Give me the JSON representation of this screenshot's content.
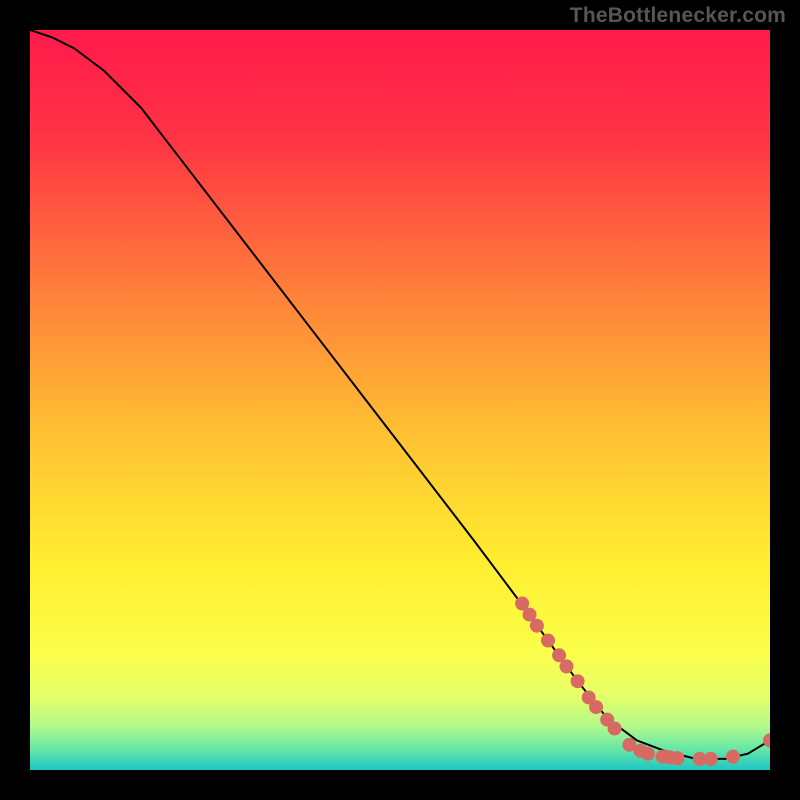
{
  "attribution": "TheBottlenecker.com",
  "colors": {
    "bg": "#000000",
    "line": "#000000",
    "marker": "#d76a63",
    "attribution": "#565656"
  },
  "chart_data": {
    "type": "line",
    "title": "",
    "xlabel": "",
    "ylabel": "",
    "xlim": [
      0,
      100
    ],
    "ylim": [
      0,
      100
    ],
    "grid": false,
    "legend": false,
    "background_gradient": {
      "stops": [
        {
          "pos": 0.0,
          "color": "#ff1a4b"
        },
        {
          "pos": 0.15,
          "color": "#ff3544"
        },
        {
          "pos": 0.35,
          "color": "#ff7e3a"
        },
        {
          "pos": 0.55,
          "color": "#ffc232"
        },
        {
          "pos": 0.72,
          "color": "#ffee2f"
        },
        {
          "pos": 0.84,
          "color": "#fbff4a"
        },
        {
          "pos": 0.9,
          "color": "#e6ff6a"
        },
        {
          "pos": 0.94,
          "color": "#b4f98a"
        },
        {
          "pos": 0.97,
          "color": "#6be8a6"
        },
        {
          "pos": 1.0,
          "color": "#1ec6c2"
        }
      ]
    },
    "series": [
      {
        "name": "bottleneck-curve",
        "x": [
          0,
          3,
          6,
          10,
          15,
          20,
          30,
          40,
          50,
          60,
          66,
          70,
          74,
          78,
          82,
          86,
          90,
          94,
          97,
          100
        ],
        "y": [
          100,
          99,
          97.5,
          94.5,
          89.5,
          83,
          70,
          57,
          44,
          31,
          23,
          17.5,
          12,
          7,
          4,
          2.5,
          1.5,
          1.5,
          2.2,
          4
        ]
      }
    ],
    "markers": [
      {
        "name": "cluster-upper-66",
        "x": 66.5,
        "y": 22.5
      },
      {
        "name": "cluster-upper-67",
        "x": 67.5,
        "y": 21.0
      },
      {
        "name": "cluster-upper-68",
        "x": 68.5,
        "y": 19.5
      },
      {
        "name": "cluster-upper-70",
        "x": 70.0,
        "y": 17.5
      },
      {
        "name": "cluster-upper-72a",
        "x": 71.5,
        "y": 15.5
      },
      {
        "name": "cluster-upper-72b",
        "x": 72.5,
        "y": 14.0
      },
      {
        "name": "cluster-upper-74",
        "x": 74.0,
        "y": 12.0
      },
      {
        "name": "cluster-upper-76a",
        "x": 75.5,
        "y": 9.8
      },
      {
        "name": "cluster-upper-76b",
        "x": 76.5,
        "y": 8.5
      },
      {
        "name": "cluster-upper-78",
        "x": 78.0,
        "y": 6.8
      },
      {
        "name": "cluster-upper-79",
        "x": 79.0,
        "y": 5.6
      },
      {
        "name": "floor-81",
        "x": 81.0,
        "y": 3.4
      },
      {
        "name": "floor-82",
        "x": 82.5,
        "y": 2.6
      },
      {
        "name": "floor-83",
        "x": 83.5,
        "y": 2.2
      },
      {
        "name": "floor-85",
        "x": 85.5,
        "y": 1.8
      },
      {
        "name": "floor-86",
        "x": 86.5,
        "y": 1.7
      },
      {
        "name": "floor-87",
        "x": 87.5,
        "y": 1.6
      },
      {
        "name": "floor-90",
        "x": 90.5,
        "y": 1.5
      },
      {
        "name": "floor-92",
        "x": 92.0,
        "y": 1.5
      },
      {
        "name": "floor-95",
        "x": 95.0,
        "y": 1.8
      },
      {
        "name": "end-100",
        "x": 100.0,
        "y": 4.0
      }
    ]
  }
}
